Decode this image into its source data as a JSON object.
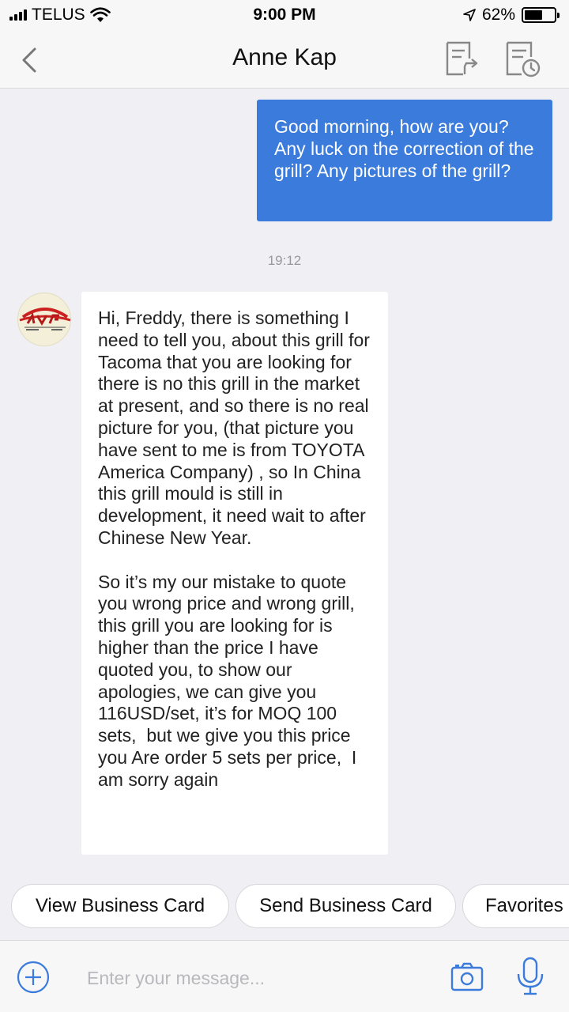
{
  "status": {
    "carrier": "TELUS",
    "time": "9:00 PM",
    "battery": "62%",
    "battery_level": 0.62
  },
  "header": {
    "title": "Anne Kap"
  },
  "messages": {
    "outgoing_text": "Good morning, how are you? Any luck on the correction of the grill? Any pictures of the grill?",
    "timestamp": "19:12",
    "incoming_text": "Hi, Freddy, there is something I need to tell you, about this grill for Tacoma that you are looking for there is no this grill in the market at present, and so there is no real picture for you, (that picture you have sent to me is from TOYOTA America Company) , so In China this grill mould is still in development, it need wait to after Chinese New Year.\n\nSo it’s my our mistake to quote you wrong price and wrong grill, this grill you are looking for is higher than the price I have quoted you, to show our apologies, we can give you  116USD/set, it’s for MOQ 100 sets,  but we give you this price you Are order 5 sets per price,  I am sorry again"
  },
  "quick_actions": {
    "view_card": "View Business Card",
    "send_card": "Send Business Card",
    "favorites": "Favorites"
  },
  "input": {
    "placeholder": "Enter your message..."
  },
  "colors": {
    "accent": "#3a7bdc",
    "background": "#efeff4"
  }
}
